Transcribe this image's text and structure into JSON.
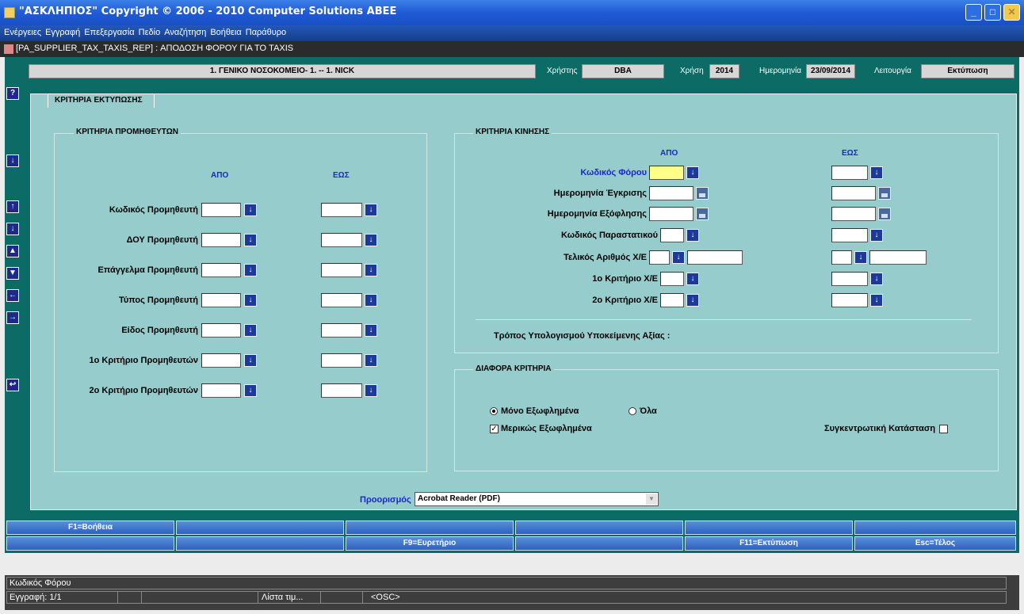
{
  "window": {
    "title": "\"ΑΣΚΛΗΠΙΟΣ\" Copyright © 2006 - 2010 Computer Solutions ΑΒΕΕ"
  },
  "menu": [
    "Ενέργειες",
    "Εγγραφή",
    "Επεξεργασία",
    "Πεδίο",
    "Αναζήτηση",
    "Βοήθεια",
    "Παράθυρο"
  ],
  "form_title": "[PA_SUPPLIER_TAX_TAXIS_REP] : ΑΠΟΔΟΣΗ ΦΟΡΟΥ ΓΙΑ ΤΟ TAXIS",
  "header": {
    "hospital": "1. ΓΕΝΙΚΟ ΝΟΣΟΚΟΜΕΙΟ- 1. -- 1. NICK",
    "user_label": "Χρήστης",
    "user": "DBA",
    "year_label": "Χρήση",
    "year": "2014",
    "date_label": "Ημερομηνία",
    "date": "23/09/2014",
    "function_label": "Λειτουργία",
    "function": "Εκτύπωση"
  },
  "tab_label": "ΚΡΙΤΗΡΙΑ ΕΚΤΥΠΩΣΗΣ",
  "suppliers": {
    "title": "ΚΡΙΤΗΡΙΑ ΠΡΟΜΗΘΕΥΤΩΝ",
    "from": "ΑΠΟ",
    "to": "ΕΩΣ",
    "rows": [
      "Κωδικός Προμηθευτή",
      "ΔΟΥ Προμηθευτή",
      "Επάγγελμα Προμηθευτή",
      "Τύπος Προμηθευτή",
      "Είδος Προμηθευτή",
      "1ο Κριτήριο Προμηθευτών",
      "2ο Κριτήριο Προμηθευτών"
    ]
  },
  "movement": {
    "title": "ΚΡΙΤΗΡΙΑ ΚΙΝΗΣΗΣ",
    "from": "ΑΠΟ",
    "to": "ΕΩΣ",
    "rows": [
      "Κωδικός Φόρου",
      "Ημερομηνία Έγκρισης",
      "Ημερομηνία Εξόφλησης",
      "Κωδικός Παραστατικού",
      "Τελικός Αριθμός Χ/Ε",
      "1ο Κριτήριο Χ/Ε",
      "2ο Κριτήριο Χ/Ε"
    ],
    "calc_label": "Τρόπος Υπολογισμού Υποκείμενης Αξίας :"
  },
  "misc": {
    "title": "ΔΙΑΦΟΡΑ ΚΡΙΤΗΡΙΑ",
    "radio_paid": "Μόνο Εξωφλημένα",
    "radio_all": "Όλα",
    "check_partial": "Μερικώς Εξωφλημένα",
    "check_summary": "Συγκεντρωτική Κατάσταση"
  },
  "destination": {
    "label": "Προορισμός",
    "value": "Acrobat Reader (PDF)"
  },
  "fkeys": {
    "f1": "F1=Βοήθεια",
    "f9": "F9=Ευρετήριο",
    "f11": "F11=Εκτύπωση",
    "esc": "Esc=Τέλος"
  },
  "status": {
    "hint": "Κωδικός Φόρου",
    "record": "Εγγραφή: 1/1",
    "lov": "Λίστα τιμ...",
    "osc": "<OSC>"
  }
}
